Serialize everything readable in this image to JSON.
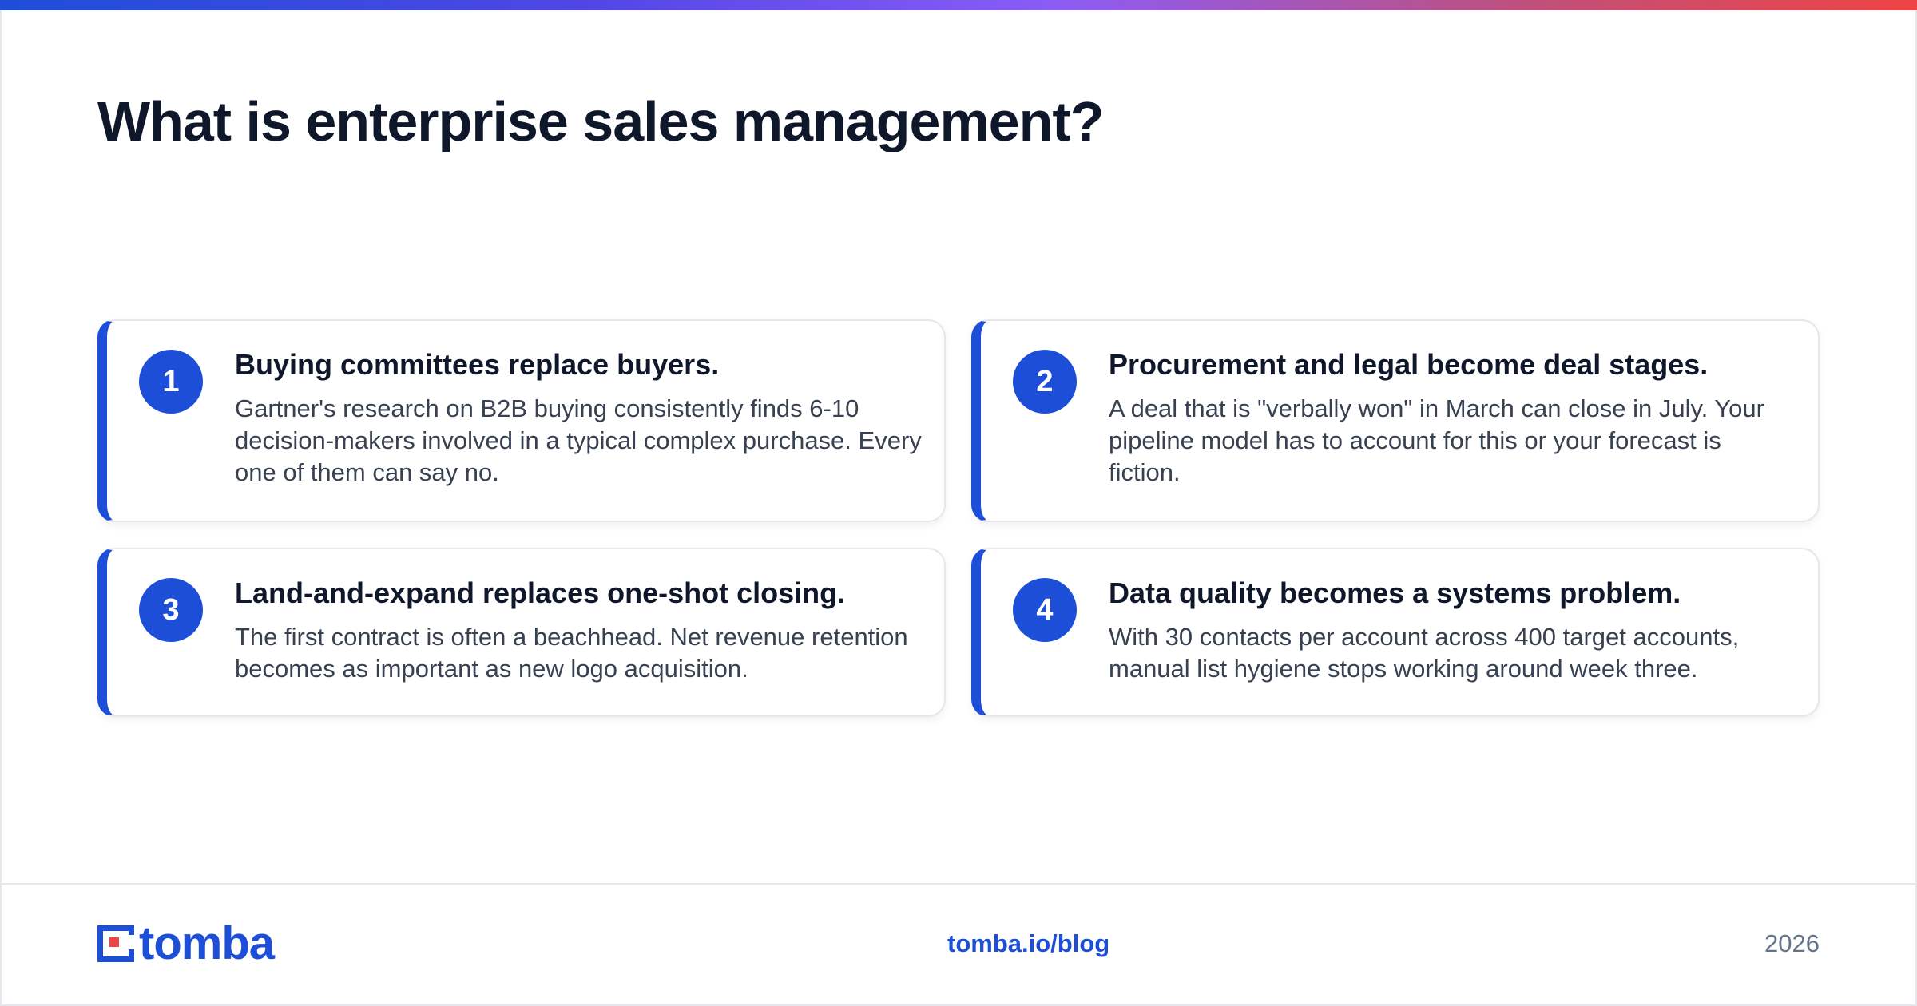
{
  "title": "What is enterprise sales management?",
  "cards": [
    {
      "number": "1",
      "heading": "Buying committees replace buyers.",
      "body": "Gartner's research on B2B buying consistently finds 6-10 decision-makers involved in a typical complex purchase. Every one of them can say no."
    },
    {
      "number": "2",
      "heading": "Procurement and legal become deal stages.",
      "body": "A deal that is \"verbally won\" in March can close in July. Your pipeline model has to account for this or your forecast is fiction."
    },
    {
      "number": "3",
      "heading": "Land-and-expand replaces one-shot closing.",
      "body": "The first contract is often a beachhead. Net revenue retention becomes as important as new logo acquisition."
    },
    {
      "number": "4",
      "heading": "Data quality becomes a systems problem.",
      "body": "With 30 contacts per account across 400 target accounts, manual list hygiene stops working around week three."
    }
  ],
  "footer": {
    "logo_text": "tomba",
    "link": "tomba.io/blog",
    "year": "2026"
  },
  "colors": {
    "accent": "#1d4ed8",
    "logo_dot": "#ef4444",
    "title": "#0f172a",
    "body_text": "#374151",
    "muted": "#64748b"
  }
}
